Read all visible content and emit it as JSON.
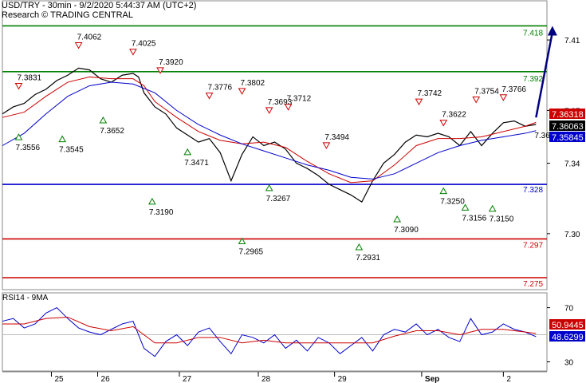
{
  "header": {
    "line1": "USD/TRY - 30min - 9/2/2020 5:44:37 AM (UTC+2)",
    "line2": "Research © TRADING CENTRAL"
  },
  "chart_data": {
    "type": "line",
    "symbol": "USD/TRY",
    "price_axis": {
      "ylim": [
        7.275,
        7.425
      ],
      "ticks": [
        {
          "value": 7.41,
          "label": "7.41"
        },
        {
          "value": 7.37,
          "label": "7.37"
        },
        {
          "value": 7.34,
          "label": "7.34"
        },
        {
          "value": 7.3,
          "label": "7.30"
        }
      ]
    },
    "x_axis": {
      "labels": [
        "25",
        "26",
        "27",
        "28",
        "29",
        "Sep",
        "2"
      ],
      "xlim": [
        0,
        100
      ]
    },
    "levels": [
      {
        "value": 7.418,
        "label": "7.418",
        "color": "#008000"
      },
      {
        "value": 7.392,
        "label": "7.392",
        "color": "#008000"
      },
      {
        "value": 7.328,
        "label": "7.328",
        "color": "#0000cc"
      },
      {
        "value": 7.297,
        "label": "7.297",
        "color": "#cc0000"
      },
      {
        "value": 7.275,
        "label": "7.275",
        "color": "#cc0000"
      }
    ],
    "price_tags": [
      {
        "value": 7.36318,
        "label": "7.36318",
        "color": "#cc0000"
      },
      {
        "value": 7.36063,
        "label": "7.36063",
        "color": "#000000"
      },
      {
        "value": 7.35845,
        "label": "7.35845",
        "color": "#0000cc"
      }
    ],
    "current_value_label": "7.3601",
    "projection": {
      "from_x": 98,
      "from_y": 7.366,
      "to_x": 101,
      "to_y": 7.418
    },
    "annotations": [
      {
        "label": "7.3831",
        "x": 3,
        "y": 7.3831,
        "kind": "high"
      },
      {
        "label": "7.4062",
        "x": 14,
        "y": 7.4062,
        "kind": "high"
      },
      {
        "label": "7.4025",
        "x": 24,
        "y": 7.4025,
        "kind": "high"
      },
      {
        "label": "7.3920",
        "x": 29,
        "y": 7.392,
        "kind": "high"
      },
      {
        "label": "7.3776",
        "x": 38,
        "y": 7.3776,
        "kind": "high"
      },
      {
        "label": "7.3802",
        "x": 44,
        "y": 7.3802,
        "kind": "high"
      },
      {
        "label": "7.3693",
        "x": 49,
        "y": 7.3693,
        "kind": "high"
      },
      {
        "label": "7.3712",
        "x": 52.5,
        "y": 7.3712,
        "kind": "high"
      },
      {
        "label": "7.3494",
        "x": 59.5,
        "y": 7.3494,
        "kind": "high"
      },
      {
        "label": "7.3742",
        "x": 76.5,
        "y": 7.3742,
        "kind": "high"
      },
      {
        "label": "7.3622",
        "x": 81,
        "y": 7.3622,
        "kind": "high"
      },
      {
        "label": "7.3754",
        "x": 87,
        "y": 7.3754,
        "kind": "high"
      },
      {
        "label": "7.3766",
        "x": 92,
        "y": 7.3766,
        "kind": "high"
      },
      {
        "label": "7.3556",
        "x": 3,
        "y": 7.3556,
        "kind": "low"
      },
      {
        "label": "7.3545",
        "x": 11,
        "y": 7.3545,
        "kind": "low"
      },
      {
        "label": "7.3652",
        "x": 18.5,
        "y": 7.3652,
        "kind": "low"
      },
      {
        "label": "7.3471",
        "x": 34,
        "y": 7.3471,
        "kind": "low"
      },
      {
        "label": "7.3190",
        "x": 27.5,
        "y": 7.319,
        "kind": "low"
      },
      {
        "label": "7.3267",
        "x": 49,
        "y": 7.3267,
        "kind": "low"
      },
      {
        "label": "7.2965",
        "x": 44,
        "y": 7.2965,
        "kind": "low"
      },
      {
        "label": "7.2931",
        "x": 65.5,
        "y": 7.2931,
        "kind": "low"
      },
      {
        "label": "7.3090",
        "x": 72.5,
        "y": 7.309,
        "kind": "low"
      },
      {
        "label": "7.3250",
        "x": 81,
        "y": 7.325,
        "kind": "low"
      },
      {
        "label": "7.3156",
        "x": 85,
        "y": 7.3156,
        "kind": "low"
      },
      {
        "label": "7.3150",
        "x": 90,
        "y": 7.315,
        "kind": "low"
      }
    ],
    "series": [
      {
        "name": "USD/TRY",
        "color": "#000000",
        "x": [
          0,
          2,
          4,
          6,
          8,
          10,
          12,
          14,
          16,
          18,
          20,
          22,
          24,
          25,
          26,
          28,
          30,
          32,
          34,
          36,
          38,
          40,
          42,
          44,
          46,
          48,
          50,
          52,
          54,
          56,
          58,
          60,
          62,
          64,
          66,
          68,
          70,
          72,
          74,
          76,
          78,
          80,
          82,
          84,
          86,
          88,
          90,
          92,
          94,
          96,
          98
        ],
        "y": [
          7.368,
          7.372,
          7.374,
          7.379,
          7.382,
          7.387,
          7.39,
          7.394,
          7.393,
          7.388,
          7.386,
          7.39,
          7.391,
          7.389,
          7.38,
          7.372,
          7.368,
          7.36,
          7.356,
          7.352,
          7.354,
          7.346,
          7.33,
          7.345,
          7.355,
          7.35,
          7.352,
          7.348,
          7.34,
          7.337,
          7.333,
          7.328,
          7.325,
          7.322,
          7.318,
          7.33,
          7.34,
          7.345,
          7.352,
          7.356,
          7.355,
          7.357,
          7.355,
          7.35,
          7.358,
          7.35,
          7.357,
          7.363,
          7.364,
          7.361,
          7.362
        ]
      },
      {
        "color": "#cc0000",
        "x": [
          0,
          4,
          8,
          12,
          16,
          20,
          24,
          26,
          28,
          32,
          36,
          40,
          44,
          48,
          52,
          56,
          60,
          64,
          68,
          72,
          76,
          80,
          84,
          88,
          92,
          96,
          98
        ],
        "y": [
          7.366,
          7.369,
          7.378,
          7.386,
          7.389,
          7.388,
          7.388,
          7.384,
          7.375,
          7.366,
          7.358,
          7.353,
          7.351,
          7.352,
          7.349,
          7.341,
          7.334,
          7.329,
          7.33,
          7.339,
          7.35,
          7.354,
          7.354,
          7.355,
          7.358,
          7.361,
          7.3632
        ]
      },
      {
        "color": "#0000cc",
        "x": [
          0,
          4,
          8,
          12,
          16,
          20,
          24,
          28,
          32,
          36,
          40,
          44,
          48,
          52,
          56,
          60,
          64,
          68,
          72,
          76,
          80,
          84,
          88,
          92,
          96,
          98
        ],
        "y": [
          7.35,
          7.357,
          7.368,
          7.378,
          7.384,
          7.386,
          7.385,
          7.38,
          7.37,
          7.362,
          7.356,
          7.351,
          7.347,
          7.343,
          7.339,
          7.336,
          7.332,
          7.331,
          7.334,
          7.34,
          7.346,
          7.35,
          7.353,
          7.355,
          7.357,
          7.3585
        ]
      }
    ],
    "rsi": {
      "title": "RSI14 - 9MA",
      "ylim": [
        25,
        78
      ],
      "ticks": [
        {
          "value": 70,
          "label": "70"
        },
        {
          "value": 50,
          "label": "50"
        },
        {
          "value": 30,
          "label": "30"
        }
      ],
      "tags": [
        {
          "value": 50.9445,
          "label": "50.9445",
          "color": "#cc0000"
        },
        {
          "value": 48.6299,
          "label": "48.6299",
          "color": "#0000cc"
        }
      ],
      "series": [
        {
          "name": "RSI14",
          "color": "#0000cc",
          "x": [
            0,
            2,
            4,
            6,
            8,
            10,
            12,
            14,
            16,
            18,
            20,
            22,
            24,
            26,
            28,
            30,
            32,
            34,
            36,
            38,
            40,
            42,
            44,
            46,
            48,
            50,
            52,
            54,
            56,
            58,
            60,
            62,
            64,
            66,
            68,
            70,
            72,
            74,
            76,
            78,
            80,
            82,
            84,
            86,
            88,
            90,
            92,
            94,
            96,
            98
          ],
          "y": [
            60,
            62,
            55,
            58,
            66,
            70,
            62,
            55,
            52,
            50,
            54,
            58,
            60,
            40,
            34,
            45,
            50,
            42,
            52,
            55,
            45,
            36,
            50,
            48,
            44,
            50,
            40,
            46,
            38,
            48,
            44,
            36,
            42,
            48,
            38,
            50,
            54,
            52,
            58,
            50,
            54,
            48,
            45,
            62,
            50,
            52,
            58,
            54,
            52,
            48.6
          ]
        },
        {
          "name": "9MA",
          "color": "#cc0000",
          "x": [
            0,
            4,
            8,
            12,
            16,
            20,
            24,
            28,
            32,
            36,
            40,
            44,
            48,
            52,
            56,
            60,
            64,
            68,
            72,
            76,
            80,
            84,
            88,
            92,
            96,
            98
          ],
          "y": [
            58,
            58,
            62,
            63,
            56,
            53,
            56,
            44,
            44,
            48,
            48,
            44,
            46,
            44,
            44,
            44,
            44,
            44,
            49,
            53,
            53,
            50,
            54,
            54,
            52,
            50.9
          ]
        }
      ]
    }
  }
}
